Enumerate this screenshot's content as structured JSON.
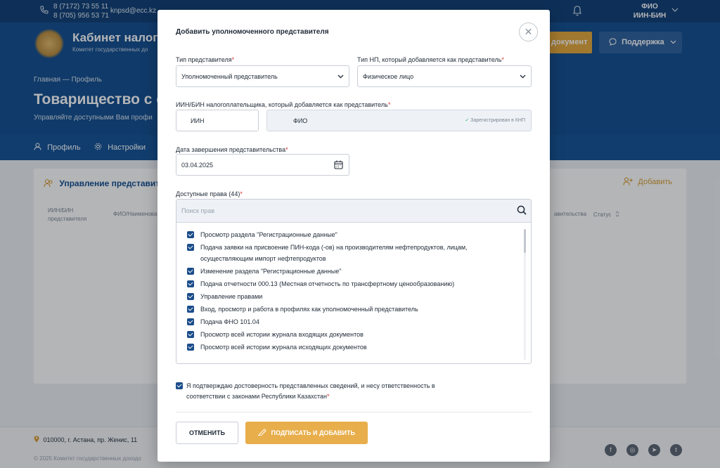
{
  "topbar": {
    "phone1": "8 (7172) 73 55 11",
    "phone2": "8 (705) 956 53 71",
    "email": "knpsd@ecc.kz",
    "user_name": "ФИО",
    "user_id": "ИИН-БИН",
    "icons": [
      "phone-icon",
      "bell-icon",
      "chevron-down-icon"
    ]
  },
  "header": {
    "title": "Кабинет налогоп",
    "subtitle": "Комитет государственных до",
    "document_button": "документ",
    "support_button": "Поддержка"
  },
  "hero": {
    "breadcrumbs": "Главная — Профиль",
    "title": "Товарищество с о",
    "subtitle": "Управляйте доступными Вам профи"
  },
  "nav": {
    "profile": "Профиль",
    "settings": "Настройки"
  },
  "panel": {
    "title": "Управление представител",
    "add_label": "Добавить",
    "col_iin": "ИИН/БИН представителя",
    "col_fio": "ФИО/Наименова",
    "col_term": "авительства",
    "col_status": "Статус"
  },
  "footer": {
    "address": "010000, г. Астана, пр. Женис, 11",
    "copyright": "© 2025 Комитет государственных доходо",
    "social": [
      "facebook-icon",
      "instagram-icon",
      "telegram-icon",
      "twitter-icon"
    ]
  },
  "modal": {
    "title": "Добавить уполномоченного представителя",
    "rep_type_label": "Тип представителя",
    "rep_type_value": "Уполномоченный представитель",
    "np_type_label": "Тип НП, который добавляется как представитель",
    "np_type_value": "Физическое лицо",
    "iin_label": "ИИН/БИН налогоплательщика, который добавляется как представитель",
    "iin_value": "ИИН",
    "fio_value": "ФИО",
    "registered_text": "Зарегистрирован в КНП",
    "date_label": "Дата завершения представительства",
    "date_value": "03.04.2025",
    "rights_label": "Доступные права (44)",
    "search_placeholder": "Поиск прав",
    "rights": [
      "Просмотр раздела \"Регистрационные данные\"",
      "Подача заявки на присвоение ПИН-кода (-ов) на производителям нефтепродуктов, лицам, осуществляющим импорт нефтепродуктов",
      "Изменение раздела \"Регистрационные данные\"",
      "Подача отчетности 000.13 (Местная отчетность по трансфертному ценообразованию)",
      "Управление правами",
      "Вход, просмотр и работа в профилях как уполномоченный представитель",
      "Подача ФНО 101.04",
      "Просмотр всей истории журнала входящих документов",
      "Просмотр всей истории журнала исходящих документов"
    ],
    "confirm_text": "Я подтверждаю достоверность представленных сведений, и несу ответственность в соответствии с законами Республики Казахстан",
    "required_mark": "*",
    "cancel_button": "ОТМЕНИТЬ",
    "sign_button": "ПОДПИСАТЬ И ДОБАВИТЬ"
  }
}
